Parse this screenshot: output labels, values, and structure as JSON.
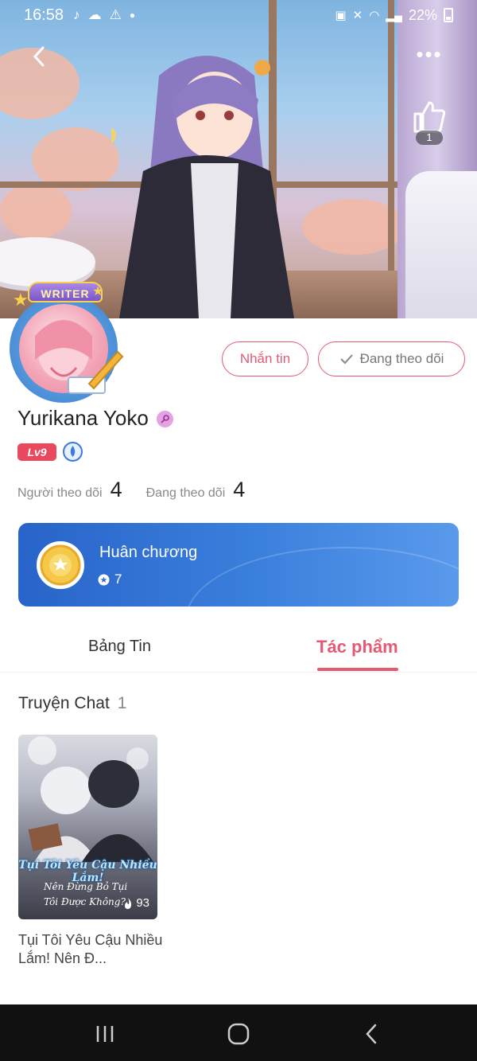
{
  "status_bar": {
    "time": "16:58",
    "battery_percent": "22%",
    "left_icons": [
      "tiktok-icon",
      "weather-icon",
      "alert-icon",
      "dot-icon"
    ],
    "right_icons": [
      "storage-icon",
      "mute-icon",
      "wifi-icon",
      "signal-icon",
      "battery-icon"
    ]
  },
  "header": {
    "like_count": "1"
  },
  "profile": {
    "writer_badge": "WRITER",
    "name": "Yurikana Yoko",
    "level": "Lv9",
    "followers_label": "Người theo dõi",
    "followers_count": "4",
    "following_label": "Đang theo dõi",
    "following_count": "4"
  },
  "actions": {
    "message_label": "Nhắn tin",
    "following_label": "Đang theo dõi"
  },
  "medal": {
    "title": "Huân chương",
    "count": "7"
  },
  "tabs": [
    {
      "label": "Bảng Tin",
      "active": false
    },
    {
      "label": "Tác phẩm",
      "active": true
    }
  ],
  "section": {
    "title": "Truyện Chat",
    "count": "1"
  },
  "stories": [
    {
      "cover_title": "Tụi Tôi Yêu Cậu Nhiều Lắm!",
      "cover_subtitle_1": "Nên Đừng Bỏ Tụi",
      "cover_subtitle_2": "Tôi Được Không?",
      "views": "93",
      "title": "Tụi Tôi Yêu Cậu Nhiều Lắm! Nên Đ..."
    }
  ],
  "colors": {
    "accent": "#e55a73",
    "medal_card": "#3b80dd",
    "level_badge": "#e8495f"
  }
}
